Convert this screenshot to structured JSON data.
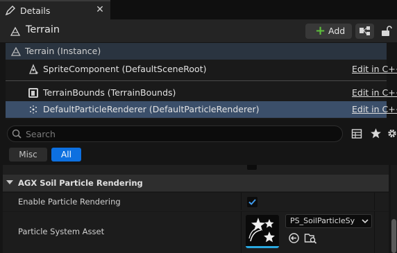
{
  "tab": {
    "title": "Details",
    "close_glyph": "✕",
    "icon": "pencil-note-icon"
  },
  "header": {
    "actor_title": "Terrain",
    "add_label": "Add",
    "add_icon": "plus-icon",
    "blueprint_icon": "blueprint-hierarchy-icon",
    "lock_icon": "unlocked-padlock-icon"
  },
  "components": {
    "root_label": "Terrain (Instance)",
    "items": [
      {
        "label": "SpriteComponent (DefaultSceneRoot)",
        "edit": "Edit in C++",
        "icon": "sprite-component-icon"
      },
      {
        "label": "TerrainBounds (TerrainBounds)",
        "edit": "Edit in C++",
        "icon": "bounds-component-icon"
      },
      {
        "label": "DefaultParticleRenderer (DefaultParticleRenderer)",
        "edit": "Edit in C++",
        "icon": "particle-renderer-icon",
        "selected": true
      }
    ]
  },
  "search": {
    "placeholder": "Search",
    "value": ""
  },
  "toolbar": {
    "table_icon": "table-view-icon",
    "favorites_icon": "star-icon",
    "settings_icon": "gear-icon"
  },
  "filters": [
    {
      "label": "Misc",
      "active": false
    },
    {
      "label": "All",
      "active": true
    }
  ],
  "details": {
    "category": "AGX Soil Particle Rendering",
    "properties": [
      {
        "label": "Enable Particle Rendering",
        "type": "checkbox",
        "checked": true
      },
      {
        "label": "Particle System Asset",
        "type": "asset",
        "value": "PS_SoilParticleSy",
        "thumbnail_icon": "particle-system-icon",
        "use_icon": "use-selected-asset-icon",
        "browse_icon": "browse-to-asset-icon"
      }
    ]
  },
  "colors": {
    "accent": "#0d70e0",
    "selection": "#3b4f6a",
    "add_plus": "#5ec13b",
    "thumbnail_bar": "#29a8e0"
  }
}
